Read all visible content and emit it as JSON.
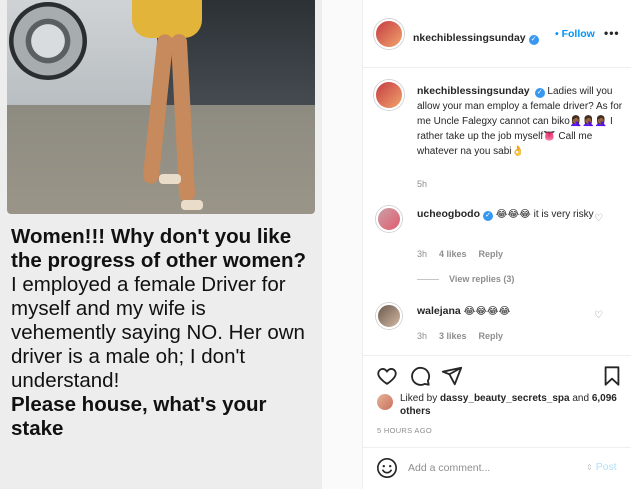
{
  "media": {
    "caption_line1": "Women!!! Why don't you like the progress of other women?",
    "caption_line2": "I employed a female Driver for myself and my wife is vehemently saying NO. Her own driver is a male oh; I don't understand!",
    "caption_line3": "Please house, what's your stake"
  },
  "header": {
    "username": "nkechiblessingsunday",
    "follow_label": "Follow",
    "more_label": "•••"
  },
  "post": {
    "username": "nkechiblessingsunday",
    "text": "Ladies will you allow your man employ a female driver? As for me Uncle Falegxy cannot can biko🤦🏾‍♀️🤦🏾‍♀️🤦🏾‍♀️ I rather take up the job myself👅 Call me whatever na you sabi👌",
    "time": "5h"
  },
  "comments": [
    {
      "username": "ucheogbodo",
      "text": "😂😂😂 it is very risky",
      "time": "3h",
      "likes": "4 likes",
      "reply": "Reply"
    },
    {
      "username": "walejana",
      "text": "😂😂😂😂",
      "time": "3h",
      "likes": "3 likes",
      "reply": "Reply"
    }
  ],
  "view_replies": "View replies (3)",
  "likes": {
    "prefix": "Liked by ",
    "user": "dassy_beauty_secrets_spa",
    "middle": " and ",
    "others": "6,096 others"
  },
  "date": "5 HOURS AGO",
  "add_comment": {
    "placeholder": "Add a comment...",
    "post_label": "Post"
  },
  "icons": {
    "verified": "verified-badge-icon",
    "like": "heart-icon",
    "comment": "comment-icon",
    "share": "paper-plane-icon",
    "save": "bookmark-icon",
    "emoji": "smiley-icon"
  },
  "colors": {
    "link_blue": "#0095f6",
    "verified_blue": "#3897f0",
    "muted": "#8e8e8e",
    "post_disabled": "#b2dffc"
  }
}
